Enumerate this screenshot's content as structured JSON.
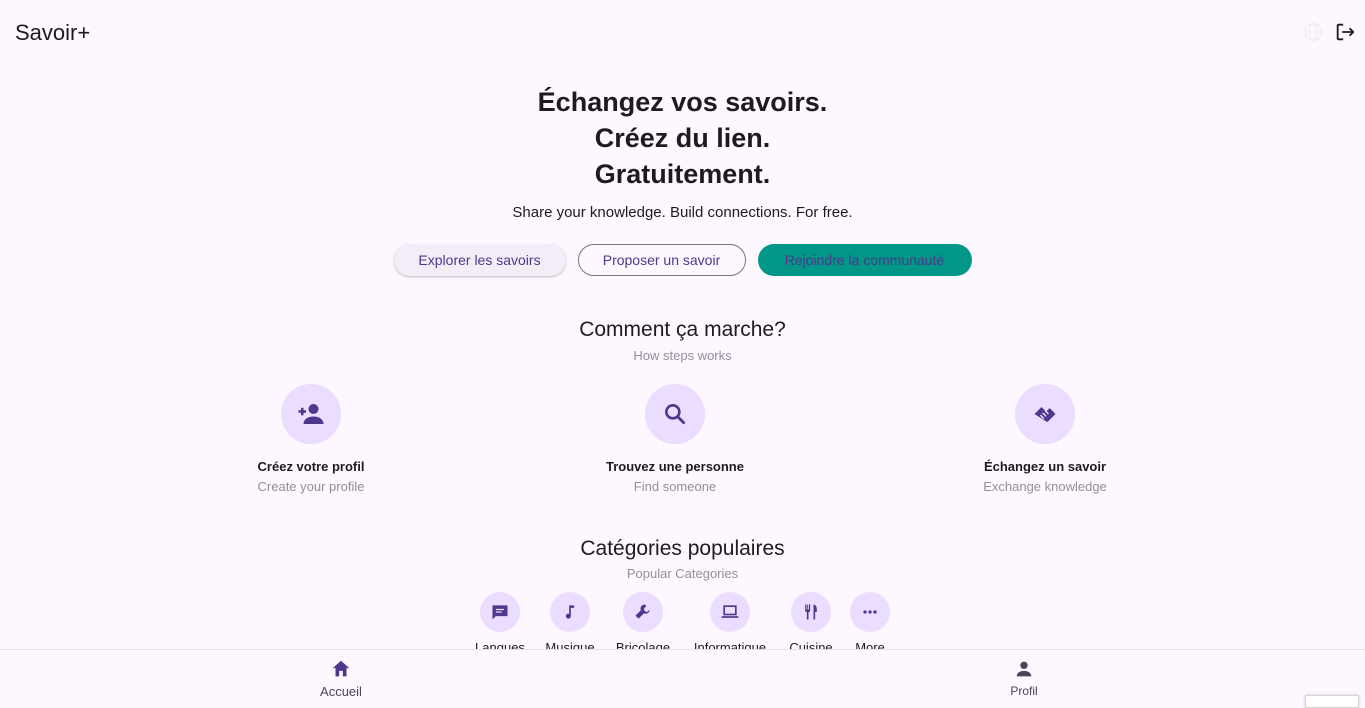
{
  "app": {
    "title": "Savoir+",
    "icons": {
      "language": "globe-icon",
      "logout": "logout-icon"
    }
  },
  "hero": {
    "headline_1": "Échangez vos savoirs.",
    "headline_2": "Créez du lien.",
    "headline_3": "Gratuitement.",
    "subtitle": "Share your knowledge. Build connections. For free."
  },
  "actions": {
    "explore": "Explorer les savoirs",
    "propose": "Proposer un savoir",
    "join": "Rejoindre la communauté"
  },
  "how_it_works": {
    "title": "Comment ça marche?",
    "subtitle": "How steps works",
    "steps": [
      {
        "icon": "person-add-icon",
        "title": "Créez votre profil",
        "subtitle": "Create your profile"
      },
      {
        "icon": "search-icon",
        "title": "Trouvez une personne",
        "subtitle": "Find someone"
      },
      {
        "icon": "handshake-icon",
        "title": "Échangez un savoir",
        "subtitle": "Exchange knowledge"
      }
    ]
  },
  "categories": {
    "title": "Catégories populaires",
    "subtitle": "Popular Categories",
    "items": [
      {
        "icon": "chat-icon",
        "label": "Langues"
      },
      {
        "icon": "music-note-icon",
        "label": "Musique"
      },
      {
        "icon": "wrench-icon",
        "label": "Bricolage"
      },
      {
        "icon": "laptop-icon",
        "label": "Informatique"
      },
      {
        "icon": "restaurant-icon",
        "label": "Cuisine"
      },
      {
        "icon": "more-horiz-icon",
        "label": "More"
      }
    ]
  },
  "bottom_nav": {
    "items": [
      {
        "icon": "home-icon",
        "label": "Accueil"
      },
      {
        "icon": "person-icon",
        "label": "Profil"
      }
    ]
  },
  "colors": {
    "background": "#fdf7ff",
    "primary": "#4f378b",
    "icon_container": "#eaddff",
    "teal_button": "#009688",
    "muted_text": "#938f99"
  }
}
